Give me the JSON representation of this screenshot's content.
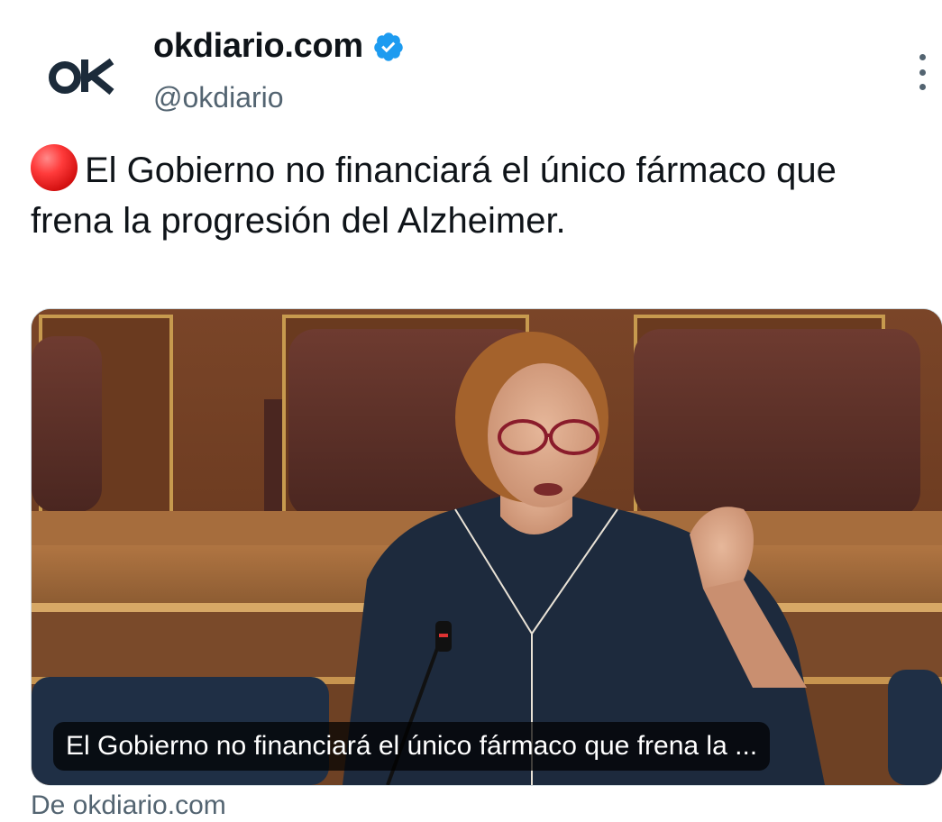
{
  "account": {
    "display_name": "okdiario.com",
    "handle": "@okdiario",
    "avatar_text": "ok",
    "verified": true
  },
  "tweet": {
    "emoji": "red-circle",
    "text": "El Gobierno no financiará el único fármaco que frena la progresión del Alzheimer."
  },
  "card": {
    "caption": "El Gobierno no financiará el único fármaco que frena la ...",
    "source": "De okdiario.com"
  },
  "icons": {
    "more": "more-vertical-icon",
    "verified": "verified-badge-icon"
  },
  "colors": {
    "verified_blue": "#1d9bf0",
    "text": "#0f1419",
    "secondary_text": "#536471",
    "logo_blue": "#1c2b3a"
  }
}
